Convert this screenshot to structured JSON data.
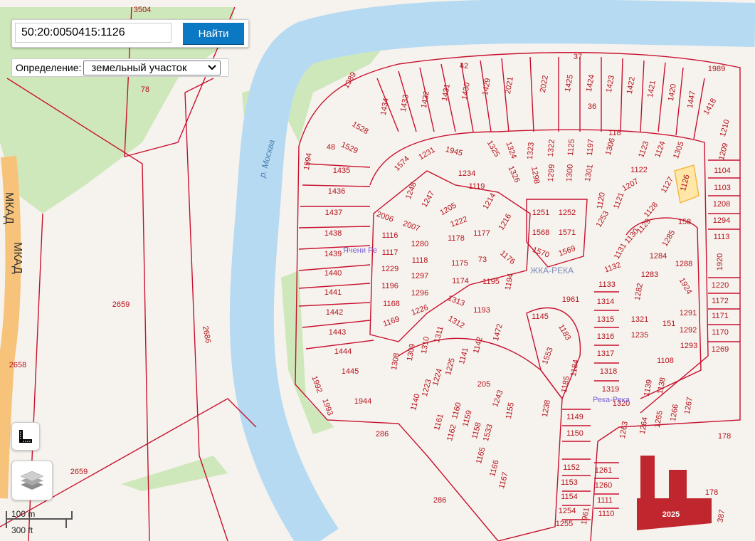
{
  "search": {
    "value": "50:20:0050415:1126",
    "button_label": "Найти"
  },
  "definition": {
    "label": "Определение:",
    "selected": "земельный участок"
  },
  "controls": {
    "ruler_icon": "ruler-icon",
    "layers_icon": "layers-icon"
  },
  "scale": {
    "metric": "100 m",
    "imperial": "300 ft"
  },
  "colors": {
    "boundary": "#c8102e",
    "river": "#b7daf3",
    "green": "#cfe8bb",
    "highlight": "#ffe7a8",
    "button": "#0a78c2"
  },
  "map_labels": [
    "р. Москва",
    "МКАД",
    "МКАД",
    "ЖКА-РЕКА",
    "Ячени Ре",
    "Река-Река"
  ],
  "parcels": [
    "1434",
    "1433",
    "1432",
    "1431",
    "1430",
    "1429",
    "2021",
    "2022",
    "1425",
    "1424",
    "1423",
    "1422",
    "1421",
    "1420",
    "1447",
    "1418",
    "1989",
    "1989",
    "42",
    "36",
    "37",
    "118",
    "1528",
    "1529",
    "1994",
    "1435",
    "1436",
    "1437",
    "1438",
    "1439",
    "1440",
    "1441",
    "1442",
    "1443",
    "1444",
    "1445",
    "1992",
    "1993",
    "1944",
    "48",
    "1574",
    "1231",
    "1945",
    "1325",
    "1324",
    "1323",
    "1322",
    "1125",
    "1197",
    "1306",
    "1123",
    "1124",
    "1305",
    "1210",
    "1209",
    "1104",
    "1103",
    "1208",
    "1294",
    "1113",
    "1920",
    "1220",
    "1172",
    "1171",
    "1170",
    "1269",
    "1234",
    "1119",
    "1326",
    "1298",
    "1299",
    "1300",
    "1301",
    "1122",
    "1207",
    "1127",
    "1126",
    "1248",
    "1247",
    "1205",
    "1214",
    "1216",
    "1222",
    "1178",
    "1177",
    "1251",
    "1252",
    "1568",
    "1571",
    "1570",
    "1569",
    "1120",
    "1253",
    "1121",
    "1128",
    "1129",
    "1130",
    "2006",
    "2007",
    "1116",
    "1280",
    "1117",
    "1118",
    "1229",
    "1297",
    "1196",
    "1296",
    "1168",
    "1226",
    "1169",
    "1175",
    "1176",
    "1174",
    "1195",
    "1194",
    "73",
    "1313",
    "1193",
    "1312",
    "1311",
    "1310",
    "1309",
    "1308",
    "1142",
    "1472",
    "1141",
    "1225",
    "1224",
    "1223",
    "1140",
    "1961",
    "1145",
    "1183",
    "1553",
    "1184",
    "1185",
    "1243",
    "1155",
    "1238",
    "1149",
    "1150",
    "1152",
    "1153",
    "1154",
    "1254",
    "1255",
    "1961",
    "1161",
    "1160",
    "1162",
    "1159",
    "1158",
    "1533",
    "1165",
    "1166",
    "1167",
    "205",
    "1131",
    "1132",
    "1133",
    "1314",
    "1315",
    "1316",
    "1317",
    "1318",
    "1319",
    "1320",
    "1263",
    "1264",
    "1265",
    "1266",
    "1267",
    "1321",
    "1235",
    "1108",
    "1139",
    "1138",
    "1291",
    "1292",
    "1293",
    "1285",
    "1284",
    "1288",
    "1283",
    "1924",
    "1282",
    "151",
    "158",
    "1261",
    "1260",
    "1111",
    "1110",
    "2025",
    "178",
    "178",
    "387",
    "286",
    "286",
    "2659",
    "2659",
    "2686",
    "2658",
    "78",
    "3504"
  ]
}
